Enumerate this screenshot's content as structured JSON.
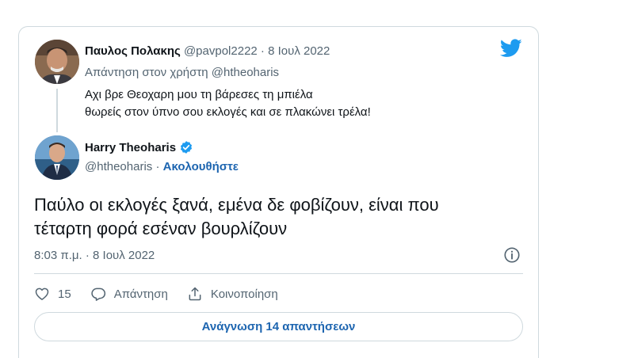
{
  "colors": {
    "accent": "#1d9bf0",
    "link": "#1d65b0",
    "muted": "#536471",
    "border": "#cfd9de"
  },
  "reply_tweet": {
    "author_name": "Παυλος Πολακης",
    "handle": "@pavpol2222",
    "separator": " · ",
    "date": "8 Ιουλ 2022",
    "reply_to_label": "Απάντηση στον χρήστη",
    "reply_to_handle": "@htheoharis",
    "text_line1": "Αχι βρε Θεοχαρη μου τη βάρεσες τη μπιέλα",
    "text_line2": "θωρείς στον ύπνο σου εκλογές και σε πλακώνει τρέλα!"
  },
  "main_tweet": {
    "author_name": "Harry Theoharis",
    "handle": "@htheoharis",
    "separator": " · ",
    "follow_label": "Ακολουθήστε",
    "text_line1": "Παύλο οι εκλογές ξανά, εμένα δε φοβίζουν, είναι που",
    "text_line2": "τέταρτη φορά εσέναν βουρλίζουν",
    "timestamp": "8:03 π.μ. · 8 Ιουλ 2022"
  },
  "actions": {
    "like_count": "15",
    "reply_label": "Απάντηση",
    "share_label": "Κοινοποίηση"
  },
  "read_replies_label": "Ανάγνωση 14 απαντήσεων"
}
